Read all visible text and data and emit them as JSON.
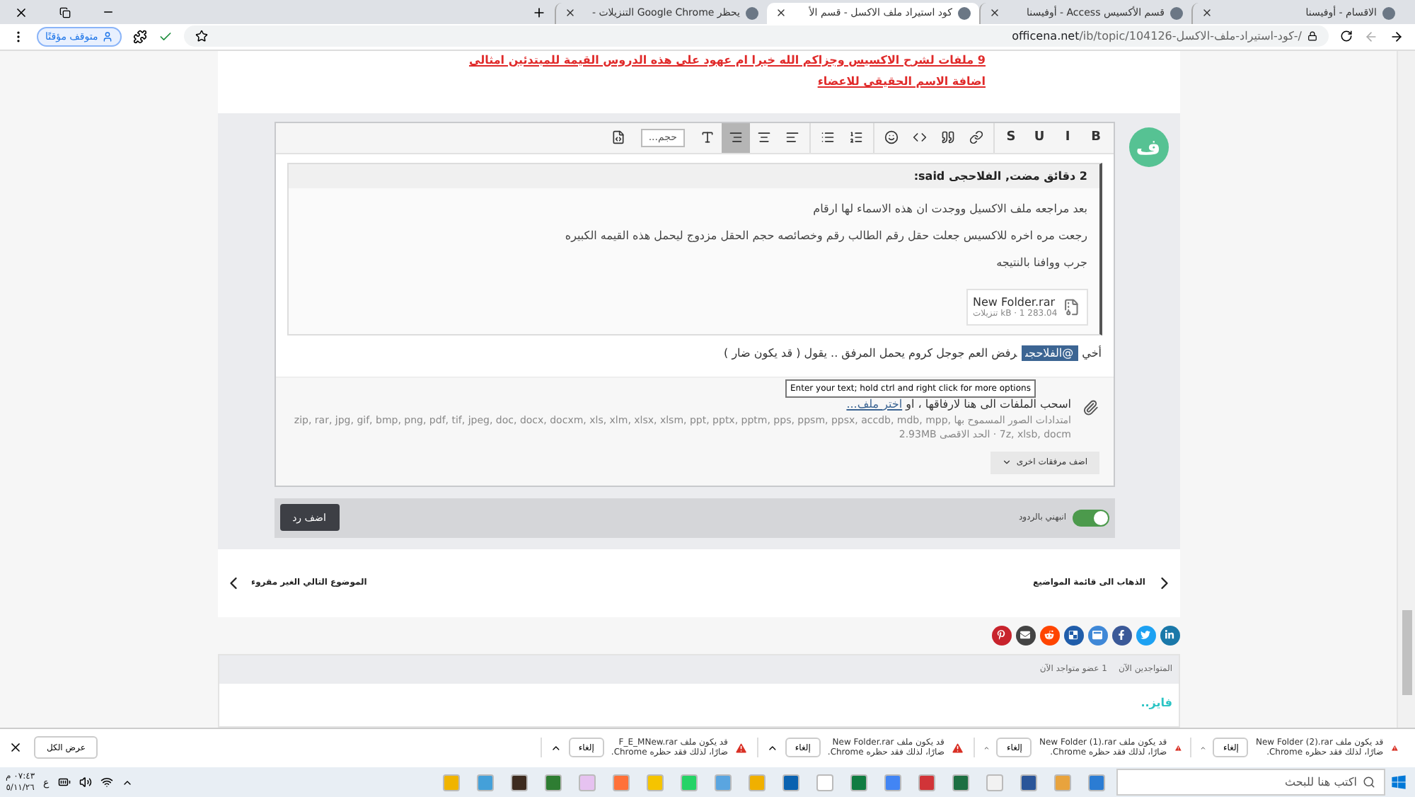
{
  "browser": {
    "tabs": [
      {
        "title": "الاقسام - أوفيسنا",
        "selected": false
      },
      {
        "title": "قسم الأكسيس Access - أوفيسنا",
        "selected": false
      },
      {
        "title": "كود استيراد ملف الاكسل - قسم الأ",
        "selected": true
      },
      {
        "title": "يحظر Google Chrome التنزيلات -",
        "selected": false
      }
    ],
    "url_domain": "officena.net",
    "url_path": "/ib/topic/104126-كود-استيراد-ملف-الاكسل-/",
    "profile": "متوقف مؤقتًا"
  },
  "signature_links": [
    "9 ملفات لشرح الاكسيس وجزاكم الله خيرا ام عهود على هذه الدروس القيمة للمبتدئين امثالي",
    "اضافة الاسم الحقيقي للاعضاء"
  ],
  "avatar_letter": "ف",
  "toolbar": {
    "format_buttons": [
      "B",
      "I",
      "U",
      "S"
    ],
    "tools": [
      {
        "selected": false
      },
      {
        "selected": false
      },
      {
        "selected": false
      },
      {
        "selected": false
      },
      {
        "selected": false
      },
      {
        "selected": false
      },
      {
        "selected": false
      },
      {
        "selected": false
      },
      {
        "selected": true
      }
    ],
    "size_select": "حجم..."
  },
  "quote": {
    "header": "2 دقائق مضت, الفلاحجى said:",
    "paragraphs": [
      "بعد مراجعه ملف الاكسيل ووجدت ان هذه الاسماء لها ارقام",
      "رجعت مره اخره للاكسيس جعلت حقل رقم الطالب رقم وخصائصه حجم الحقل مزدوج ليحمل هذه القيمه الكبيره",
      "جرب ووافنا بالنتيجه"
    ],
    "attachment": {
      "name": "New Folder.rar",
      "meta": "283.04 kB · 1 تنزيلات"
    }
  },
  "reply": {
    "before": "أخي",
    "mention": "@الفلاحجى",
    "after": "رفض العم جوجل كروم يحمل المرفق .. يقول ( قد يكون ضار )"
  },
  "tooltip": "Enter your text; hold ctrl and right click for more options",
  "attach": {
    "drop_text": "اسحب الملفات الى هنا لارفاقها ، او",
    "choose_link": "اختر ملف...",
    "extensions": "امتدادات الصور المسموح بها zip, rar, jpg, gif, bmp, png, pdf, tif, jpeg, doc, docx, docxm, xls, xlm, xlsx, xlsm, ppt, pptx, pptm, pps, ppsm, ppsx, accdb, mdb, mpp, 7z, xlsb, docm · الحد الاقصى 2.93MB",
    "more_button": "اضف مرفقات اخرى"
  },
  "notify": {
    "label": "انبهني بالردود",
    "on": true
  },
  "submit": "اضف رد",
  "nav": {
    "back": "الذهاب الى قائمة المواضيع",
    "next": "الموضوع التالي الغير مقروء"
  },
  "share": [
    {
      "color": "#1a78a9"
    },
    {
      "color": "#1da1f2"
    },
    {
      "color": "#3b5998"
    },
    {
      "color": "#3f88d7"
    },
    {
      "color": "#205daa"
    },
    {
      "color": "#ff4500"
    },
    {
      "color": "#444444"
    },
    {
      "color": "#c8232c"
    }
  ],
  "online": {
    "title": "المتواجدين الآن",
    "count": "1 عضو متواجد الآن",
    "members": [
      "فايز.."
    ]
  },
  "downloads": {
    "items": [
      {
        "line1": "قد يكون ملف New Folder (2).rar",
        "line2": "ضارًا، لذلك فقد حظره Chrome.",
        "button": "إلغاء"
      },
      {
        "line1": "قد يكون ملف New Folder (1).rar",
        "line2": "ضارًا، لذلك فقد حظره Chrome.",
        "button": "إلغاء"
      },
      {
        "line1": "قد يكون ملف New Folder.rar",
        "line2": "ضارًا، لذلك فقد حظره Chrome.",
        "button": "إلغاء"
      },
      {
        "line1": "قد يكون ملف F_E_MNew.rar",
        "line2": "ضارًا، لذلك فقد حظره Chrome.",
        "button": "إلغاء"
      }
    ],
    "show_all": "عرض الكل"
  },
  "taskbar": {
    "search_placeholder": "اكتب هنا للبحث",
    "language": "ع",
    "time": "٠٧:٤٣ م",
    "date": "٥/١١/٢٦"
  }
}
